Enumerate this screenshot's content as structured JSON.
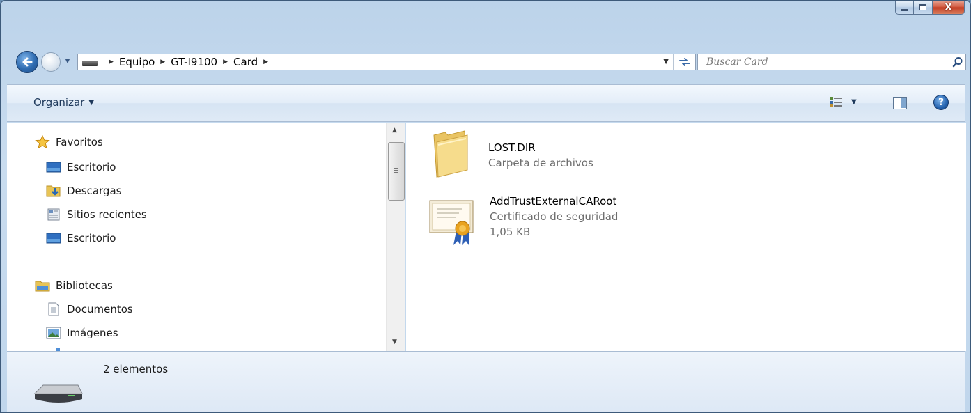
{
  "window": {
    "close_glyph": "X"
  },
  "address_bar": {
    "breadcrumbs": [
      "Equipo",
      "GT-I9100",
      "Card"
    ]
  },
  "search": {
    "placeholder": "Buscar Card"
  },
  "toolbar": {
    "organize_label": "Organizar",
    "help_glyph": "?"
  },
  "sidebar": {
    "favorites_label": "Favoritos",
    "favorites_items": [
      "Escritorio",
      "Descargas",
      "Sitios recientes",
      "Escritorio"
    ],
    "libraries_label": "Bibliotecas",
    "libraries_items": [
      "Documentos",
      "Imágenes"
    ]
  },
  "files": [
    {
      "name": "LOST.DIR",
      "type": "Carpeta de archivos",
      "icon": "folder-icon"
    },
    {
      "name": "AddTrustExternalCARoot",
      "type": "Certificado de seguridad",
      "size": "1,05 KB",
      "icon": "certificate-icon"
    }
  ],
  "status": {
    "count": "2 elementos"
  },
  "colors": {
    "accent": "#3a6aa8",
    "close_red": "#c23b22",
    "folder_yellow": "#f1d27a"
  }
}
